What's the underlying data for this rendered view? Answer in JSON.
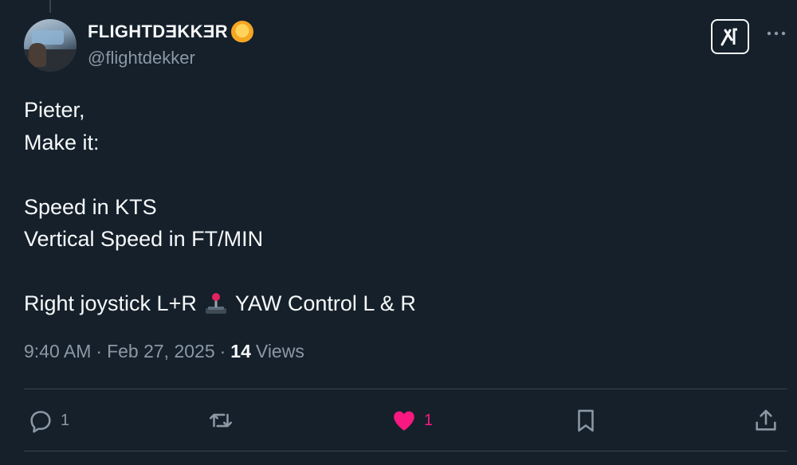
{
  "author": {
    "display_name": "FLIGHTDƎKKƎR",
    "handle": "@flightdekker",
    "emoji_icon": "sun-with-face-icon"
  },
  "tweet": {
    "lines": [
      "Pieter,",
      "Make it:",
      "",
      "Speed in KTS",
      "Vertical Speed in FT/MIN",
      "",
      "Right joystick L+R",
      "YAW Control L & R"
    ]
  },
  "meta": {
    "time": "9:40 AM",
    "separator": "·",
    "date": "Feb 27, 2025",
    "views_count": "14",
    "views_label": "Views"
  },
  "actions": {
    "reply_count": "1",
    "retweet_count": "",
    "like_count": "1",
    "bookmark_count": "",
    "share_count": ""
  },
  "colors": {
    "background": "#15202b",
    "text": "#f7f9f9",
    "secondary": "#8b98a5",
    "like": "#f91880",
    "divider": "#38444d"
  }
}
